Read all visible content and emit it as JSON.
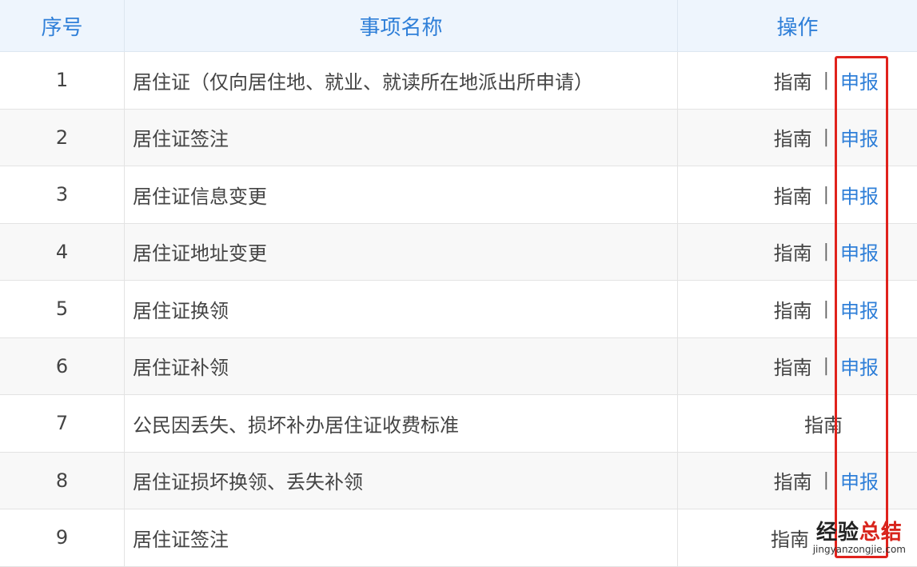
{
  "headers": {
    "no": "序号",
    "name": "事项名称",
    "op": "操作"
  },
  "rows": [
    {
      "no": "1",
      "name": "居住证（仅向居住地、就业、就读所在地派出所申请）",
      "guide": "指南",
      "sep": "|",
      "apply": "申报"
    },
    {
      "no": "2",
      "name": "居住证签注",
      "guide": "指南",
      "sep": "|",
      "apply": "申报"
    },
    {
      "no": "3",
      "name": "居住证信息变更",
      "guide": "指南",
      "sep": "|",
      "apply": "申报"
    },
    {
      "no": "4",
      "name": "居住证地址变更",
      "guide": "指南",
      "sep": "|",
      "apply": "申报"
    },
    {
      "no": "5",
      "name": "居住证换领",
      "guide": "指南",
      "sep": "|",
      "apply": "申报"
    },
    {
      "no": "6",
      "name": "居住证补领",
      "guide": "指南",
      "sep": "|",
      "apply": "申报"
    },
    {
      "no": "7",
      "name": "公民因丢失、损坏补办居住证收费标准",
      "guide": "指南"
    },
    {
      "no": "8",
      "name": "居住证损坏换领、丢失补领",
      "guide": "指南",
      "sep": "|",
      "apply": "申报"
    },
    {
      "no": "9",
      "name": "居住证签注",
      "guide": "指南"
    }
  ],
  "watermark": {
    "main_part1": "经验",
    "main_part2": "总结",
    "sub": "jingyanzongjie.com"
  },
  "colors": {
    "accent": "#2f7fd8",
    "highlight": "#e0221c",
    "header_bg": "#eef5fd"
  }
}
